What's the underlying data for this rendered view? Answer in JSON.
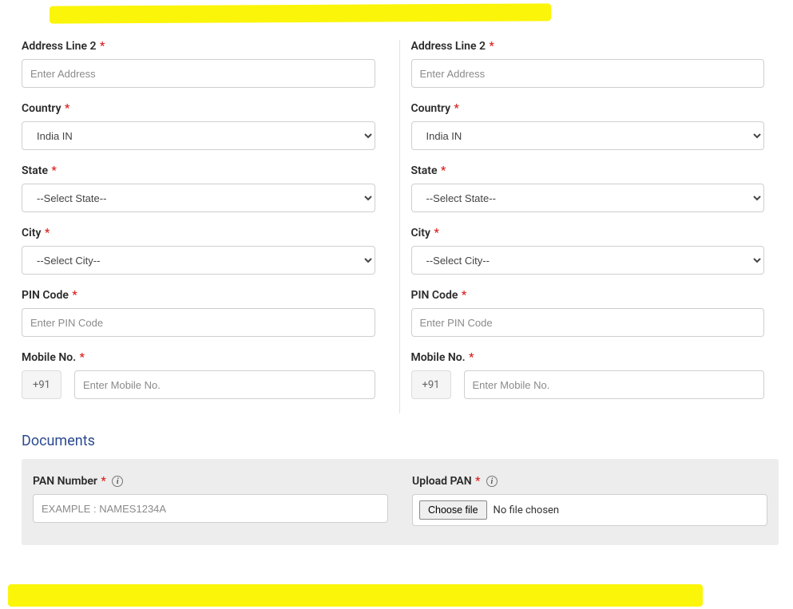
{
  "left": {
    "addr2_label": "Address Line 2",
    "addr2_ph": "Enter Address",
    "country_label": "Country",
    "country_value": "India IN",
    "state_label": "State",
    "state_value": "--Select State--",
    "city_label": "City",
    "city_value": "--Select City--",
    "pin_label": "PIN Code",
    "pin_ph": "Enter PIN Code",
    "mobile_label": "Mobile No.",
    "mobile_prefix": "+91",
    "mobile_ph": "Enter Mobile No."
  },
  "right": {
    "addr2_label": "Address Line 2",
    "addr2_ph": "Enter Address",
    "country_label": "Country",
    "country_value": "India IN",
    "state_label": "State",
    "state_value": "--Select State--",
    "city_label": "City",
    "city_value": "--Select City--",
    "pin_label": "PIN Code",
    "pin_ph": "Enter PIN Code",
    "mobile_label": "Mobile No.",
    "mobile_prefix": "+91",
    "mobile_ph": "Enter Mobile No."
  },
  "docs": {
    "section_title": "Documents",
    "pan_label": "PAN Number",
    "pan_ph": "EXAMPLE : NAMES1234A",
    "upload_label": "Upload PAN",
    "choose_btn": "Choose file",
    "no_file": "No file chosen"
  },
  "req": "*",
  "info_glyph": "i"
}
